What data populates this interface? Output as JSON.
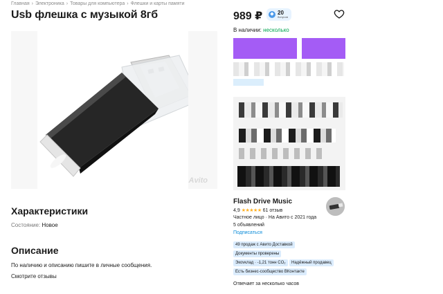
{
  "breadcrumbs": [
    "Главная",
    "Электроника",
    "Товары для компьютера",
    "Флешки и карты памяти"
  ],
  "breadcrumb_separator": "›",
  "title": "Usb флешка с музыкой 8гб",
  "gallery": {
    "watermark": "Avito"
  },
  "characteristics": {
    "heading": "Характеристики",
    "condition_label": "Состояние:",
    "condition_value": "Новое"
  },
  "description": {
    "heading": "Описание",
    "text": "По наличию и описанию пишите в личные сообщения.",
    "reviews_link": "Смотрите отзывы"
  },
  "price": {
    "amount": "989 ₽",
    "bonus_points": "20",
    "bonus_label": "бонусов"
  },
  "availability": {
    "label": "В наличии:",
    "value": "несколько"
  },
  "seller": {
    "name": "Flash Drive Music",
    "rating": "4,9",
    "stars": "★★★★★",
    "reviews": "61 отзыв",
    "type_since": "Частное лицо · На Авито с 2021 года",
    "listings": "5 объявлений",
    "subscribe": "Подписаться",
    "badges": [
      "49 продаж с Авито Доставкой",
      "Документы проверены",
      "Экovклад · -1,21 тонн CO₂",
      "Надёжный продавец",
      "Есть бизнес-сообщество ВКонтакте"
    ],
    "reply_time": "Отвечает за несколько часов"
  },
  "colors": {
    "accent_purple": "#a45cf5",
    "in_stock_green": "#02a44f",
    "link_blue": "#0a8bd8",
    "badge_bg": "#dbecfd",
    "star": "#ffb021"
  }
}
